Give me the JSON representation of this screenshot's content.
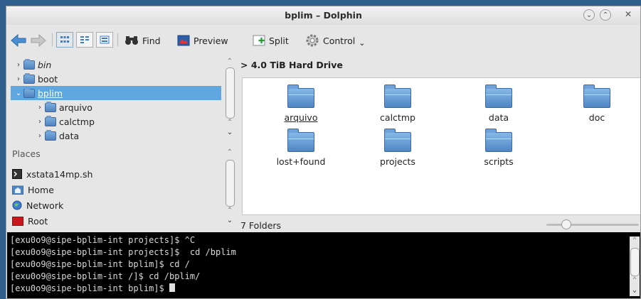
{
  "window": {
    "title": "bplim – Dolphin"
  },
  "toolbar": {
    "find_label": "Find",
    "preview_label": "Preview",
    "split_label": "Split",
    "control_label": "Control",
    "control_arrow": "⌄"
  },
  "tree": {
    "items": [
      {
        "label": "bin",
        "italic": true
      },
      {
        "label": "boot"
      },
      {
        "label": "bplim",
        "selected": true
      },
      {
        "label": "arquivo"
      },
      {
        "label": "calctmp"
      },
      {
        "label": "data"
      }
    ]
  },
  "places": {
    "header": "Places",
    "items": [
      {
        "label": "xstata14mp.sh",
        "icon": "script-icon"
      },
      {
        "label": "Home",
        "icon": "home-icon"
      },
      {
        "label": "Network",
        "icon": "network-icon"
      },
      {
        "label": "Root",
        "icon": "root-folder-icon"
      }
    ]
  },
  "main": {
    "breadcrumb": "> 4.0 TiB Hard Drive",
    "items": [
      {
        "label": "arquivo"
      },
      {
        "label": "calctmp"
      },
      {
        "label": "data"
      },
      {
        "label": "doc"
      },
      {
        "label": "lost+found"
      },
      {
        "label": "projects"
      },
      {
        "label": "scripts"
      }
    ],
    "status": "7 Folders"
  },
  "terminal": {
    "lines": [
      "[exu0o9@sipe-bplim-int projects]$ ^C",
      "[exu0o9@sipe-bplim-int projects]$  cd /bplim",
      "[exu0o9@sipe-bplim-int bplim]$ cd /",
      "[exu0o9@sipe-bplim-int /]$ cd /bplim/",
      "[exu0o9@sipe-bplim-int bplim]$ "
    ]
  },
  "colors": {
    "selection": "#5fa7e1",
    "folder": "#4f86c4",
    "terminal_bg": "#000000"
  }
}
